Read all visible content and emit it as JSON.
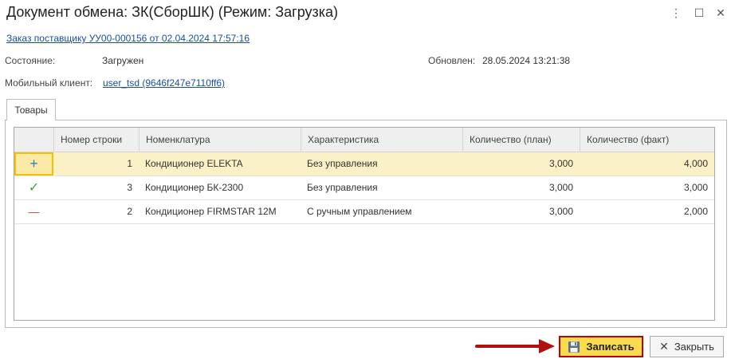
{
  "window": {
    "title": "Документ обмена: ЗК(СборШК) (Режим: Загрузка)",
    "menu_glyph": "⋮",
    "maximize_glyph": "☐",
    "close_glyph": "✕"
  },
  "header": {
    "order_link": "Заказ поставщику УУ00-000156 от 02.04.2024 17:57:16",
    "state_label": "Состояние:",
    "state_value": "Загружен",
    "updated_label": "Обновлен:",
    "updated_value": "28.05.2024 13:21:38",
    "mobile_label": "Мобильный клиент:",
    "mobile_link": "user_tsd (9646f247e7110ff6)"
  },
  "tabs": [
    {
      "label": "Товары"
    }
  ],
  "table": {
    "columns": [
      "",
      "Номер строки",
      "Номенклатура",
      "Характеристика",
      "Количество (план)",
      "Количество (факт)"
    ],
    "rows": [
      {
        "status_icon": "plus-icon",
        "status_glyph": "+",
        "status_color": "#3a7fc1",
        "num": "1",
        "item": "Кондиционер ELEKTA",
        "char": "Без управления",
        "plan": "3,000",
        "fact": "4,000"
      },
      {
        "status_icon": "check-icon",
        "status_glyph": "✓",
        "status_color": "#3aa343",
        "num": "3",
        "item": "Кондиционер БК-2300",
        "char": "Без управления",
        "plan": "3,000",
        "fact": "3,000"
      },
      {
        "status_icon": "minus-icon",
        "status_glyph": "—",
        "status_color": "#e0483b",
        "num": "2",
        "item": "Кондиционер FIRMSTAR 12M",
        "char": "С ручным управлением",
        "plan": "3,000",
        "fact": "2,000"
      }
    ]
  },
  "footer": {
    "save_label": "Записать",
    "close_label": "Закрыть",
    "close_glyph": "✕"
  },
  "colors": {
    "accent_button": "#f9dc4d",
    "annotation_red": "#c00000",
    "selected_row": "#fbf1c7"
  }
}
